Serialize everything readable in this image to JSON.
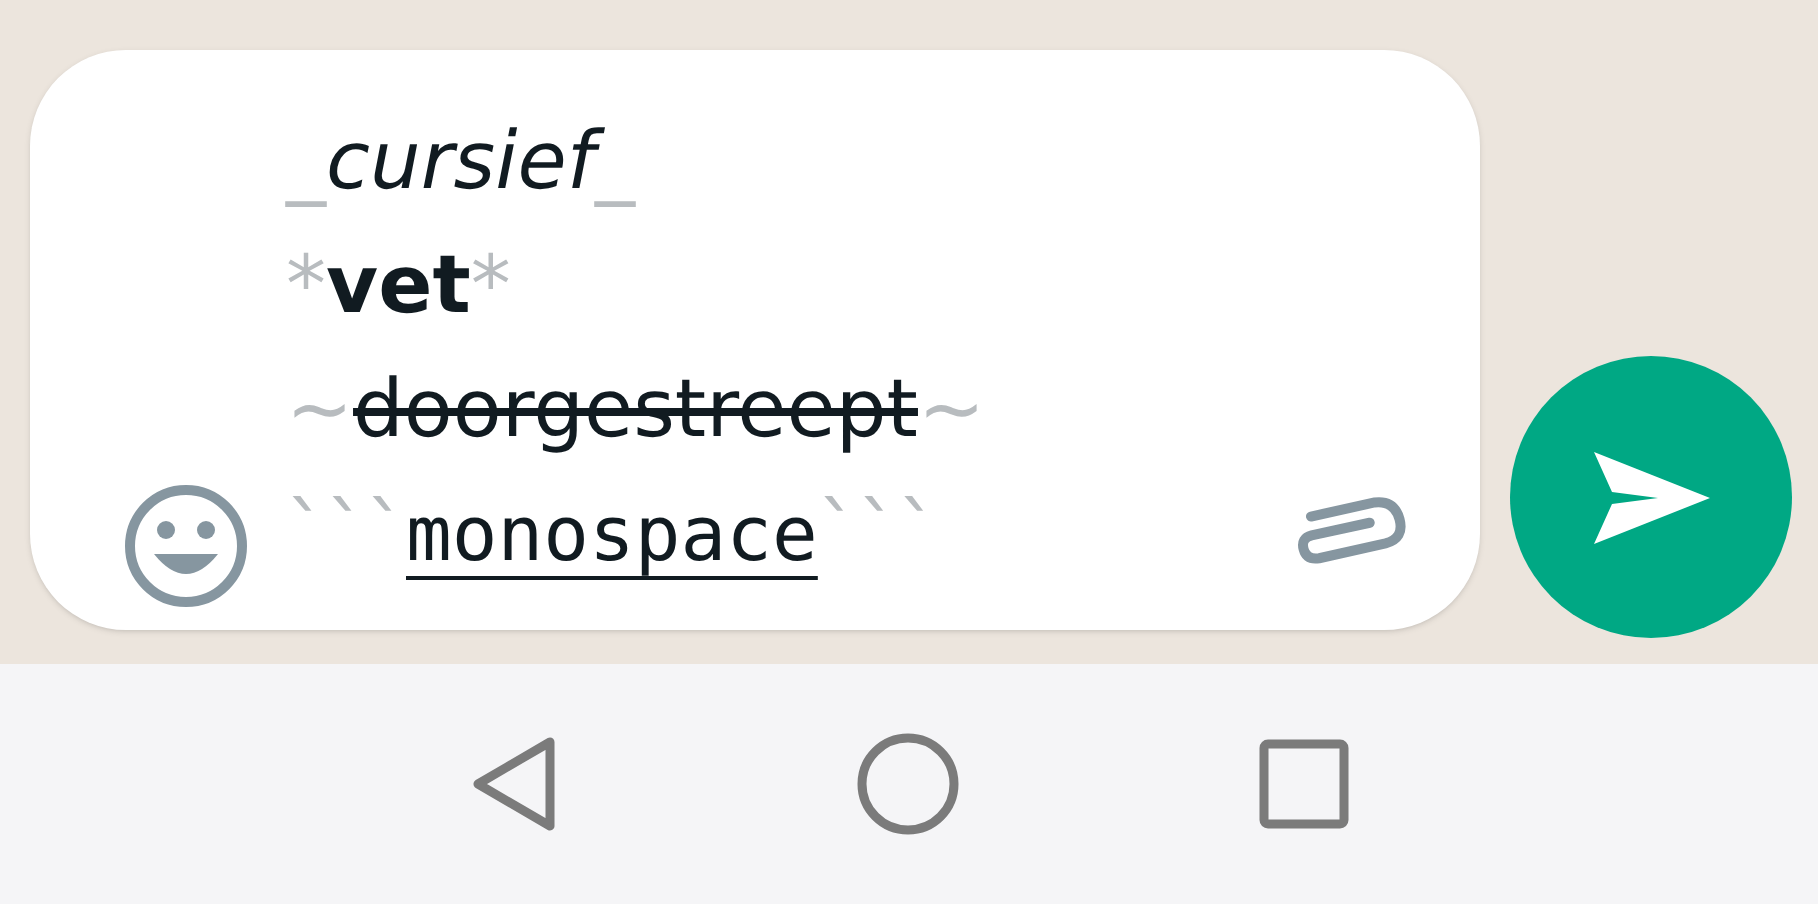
{
  "composer": {
    "lines": [
      {
        "kind": "italic",
        "marker": "_",
        "text": "cursief",
        "underlined": false
      },
      {
        "kind": "bold",
        "marker": "*",
        "text": "vet",
        "underlined": false
      },
      {
        "kind": "strike",
        "marker": "~",
        "text": "doorgestreept",
        "underlined": false
      },
      {
        "kind": "mono",
        "marker": "```",
        "text": "monospace",
        "underlined": true
      }
    ]
  }
}
